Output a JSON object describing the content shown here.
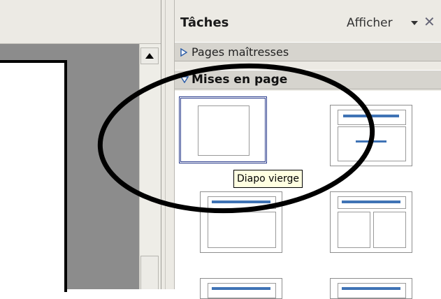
{
  "task_pane": {
    "title": "Tâches",
    "view_label": "Afficher",
    "close_glyph": "✕",
    "sections": {
      "master_pages": "Pages maîtresses",
      "layouts": "Mises en page"
    }
  },
  "tooltip": "Diapo vierge",
  "colors": {
    "pane_bg": "#eceae4",
    "section_bg": "#d6d4ce",
    "workspace_gray": "#8c8c8c",
    "layout_bar": "#3f73b5",
    "selection": "#2a3c8c",
    "tooltip_bg": "#ffffe1"
  },
  "icons": [
    "triangle-right-icon",
    "triangle-down-icon",
    "dropdown-caret-icon",
    "close-icon",
    "scroll-up-arrow-icon"
  ]
}
